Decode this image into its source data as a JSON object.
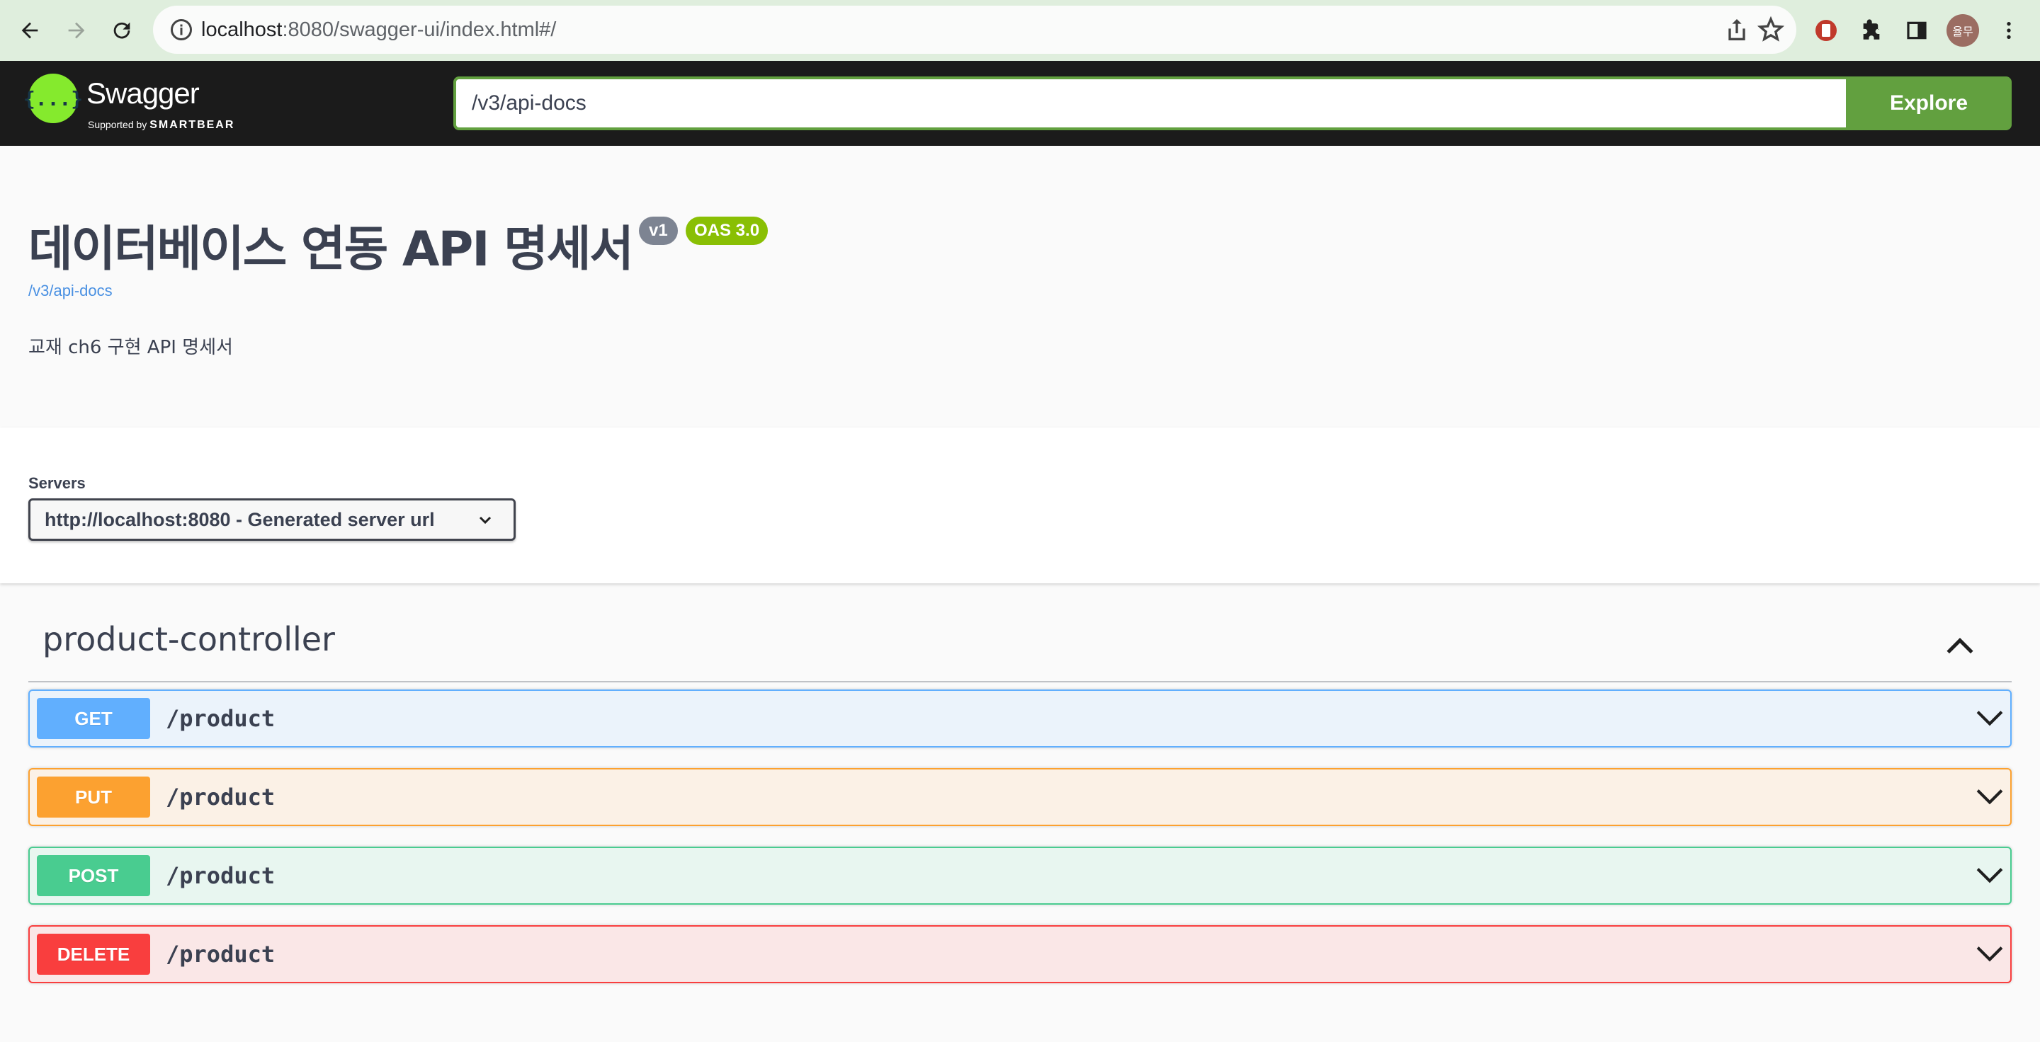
{
  "browser": {
    "url_host": "localhost",
    "url_path": ":8080/swagger-ui/index.html#/",
    "profile_label": "율무"
  },
  "topbar": {
    "logo_text": "Swagger",
    "logo_sub_prefix": "Supported by",
    "logo_sub_brand": "SMARTBEAR",
    "logo_glyph": "{...}",
    "spec_url": "/v3/api-docs",
    "explore_label": "Explore"
  },
  "info": {
    "title": "데이터베이스 연동 API 명세서",
    "version_badge": "v1",
    "oas_badge": "OAS 3.0",
    "spec_link": "/v3/api-docs",
    "description": "교재 ch6 구현 API 명세서"
  },
  "servers": {
    "label": "Servers",
    "selected": "http://localhost:8080 - Generated server url"
  },
  "tag": {
    "name": "product-controller",
    "operations": [
      {
        "method": "GET",
        "path": "/product",
        "color": "#61affe"
      },
      {
        "method": "PUT",
        "path": "/product",
        "color": "#fca130"
      },
      {
        "method": "POST",
        "path": "/product",
        "color": "#49cc90"
      },
      {
        "method": "DELETE",
        "path": "/product",
        "color": "#f93e3e"
      }
    ]
  }
}
